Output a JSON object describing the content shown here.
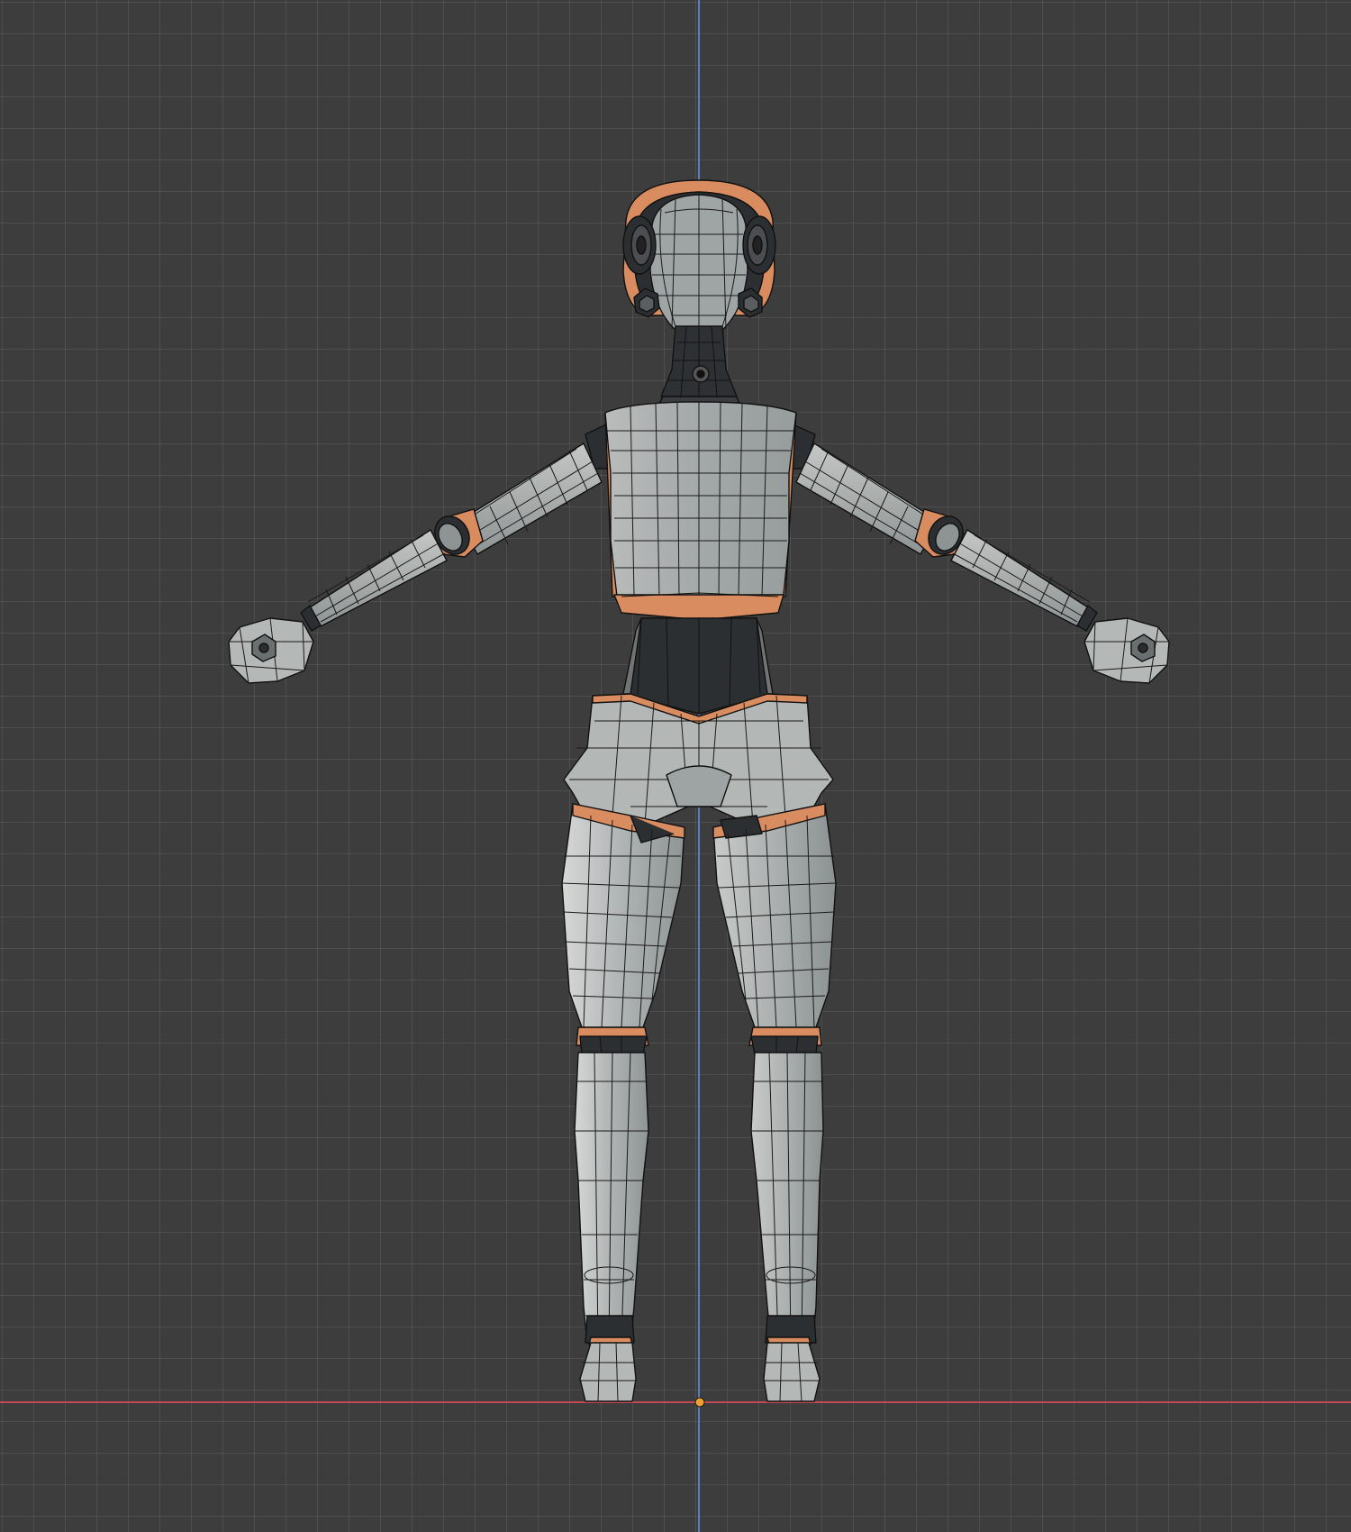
{
  "viewport": {
    "view": "front-orthographic",
    "shading": "solid",
    "overlay": "wireframe"
  },
  "colors": {
    "background": "#3d3d3d",
    "grid": "#555555",
    "axis_z": "#5680c2",
    "axis_x": "#c24a55",
    "origin": "#f0a030",
    "mesh": "#a9aeae",
    "mesh_light": "#c8cbca",
    "mesh_dark": "#2c2f31",
    "seam_orange": "#d98c5f",
    "wire": "#111111"
  },
  "scene": {
    "object": "character-mesh",
    "pose": "a-pose"
  }
}
